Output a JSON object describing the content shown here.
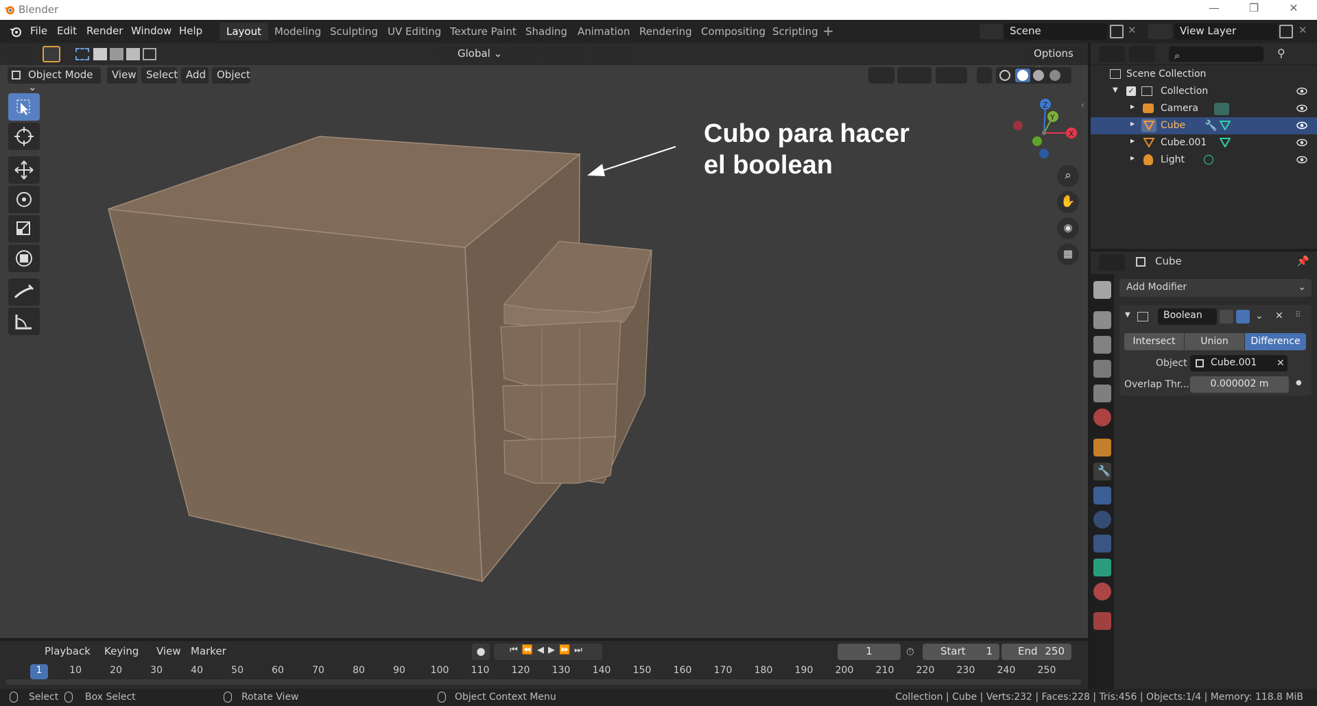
{
  "app": {
    "title": "Blender"
  },
  "menu": [
    "File",
    "Edit",
    "Render",
    "Window",
    "Help"
  ],
  "workspaces": {
    "active": "Layout",
    "tabs": [
      "Layout",
      "Modeling",
      "Sculpting",
      "UV Editing",
      "Texture Paint",
      "Shading",
      "Animation",
      "Rendering",
      "Compositing",
      "Scripting"
    ]
  },
  "scene": {
    "name": "Scene",
    "view_layer": "View Layer"
  },
  "viewport": {
    "mode": "Object Mode",
    "menus": [
      "View",
      "Select",
      "Add",
      "Object"
    ],
    "orientation": "Global",
    "options_label": "Options",
    "annotation_line1": "Cubo para hacer",
    "annotation_line2": "el boolean",
    "gizmo": {
      "x": "X",
      "y": "Y",
      "z": "Z"
    }
  },
  "outliner": {
    "root": "Scene Collection",
    "collection": "Collection",
    "items": [
      {
        "name": "Camera",
        "icon": "camera-icon",
        "selected": false
      },
      {
        "name": "Cube",
        "icon": "mesh-icon",
        "selected": true
      },
      {
        "name": "Cube.001",
        "icon": "mesh-icon",
        "selected": false
      },
      {
        "name": "Light",
        "icon": "light-icon",
        "selected": false
      }
    ]
  },
  "properties": {
    "object_name": "Cube",
    "add_modifier": "Add Modifier",
    "modifier": {
      "name": "Boolean",
      "operations": [
        "Intersect",
        "Union",
        "Difference"
      ],
      "active_operation": "Difference",
      "object_label": "Object",
      "object_value": "Cube.001",
      "overlap_label": "Overlap Thr...",
      "overlap_value": "0.000002 m"
    }
  },
  "timeline": {
    "menus": [
      "Playback",
      "Keying",
      "View",
      "Marker"
    ],
    "current_frame": "1",
    "start_label": "Start",
    "start": "1",
    "end_label": "End",
    "end": "250",
    "ticks": [
      "1",
      "10",
      "20",
      "30",
      "40",
      "50",
      "60",
      "70",
      "80",
      "90",
      "100",
      "110",
      "120",
      "130",
      "140",
      "150",
      "160",
      "170",
      "180",
      "190",
      "200",
      "210",
      "220",
      "230",
      "240",
      "250"
    ]
  },
  "status": {
    "select": "Select",
    "box_select": "Box Select",
    "rotate_view": "Rotate View",
    "context_menu": "Object Context Menu",
    "stats": "Collection | Cube | Verts:232 | Faces:228 | Tris:456 | Objects:1/4 | Memory: 118.8 MiB"
  },
  "colors": {
    "accent": "#4772b3",
    "selected_row": "#334d80",
    "viewport_bg": "#3d3d3d",
    "mesh": "#7d6b5a"
  }
}
